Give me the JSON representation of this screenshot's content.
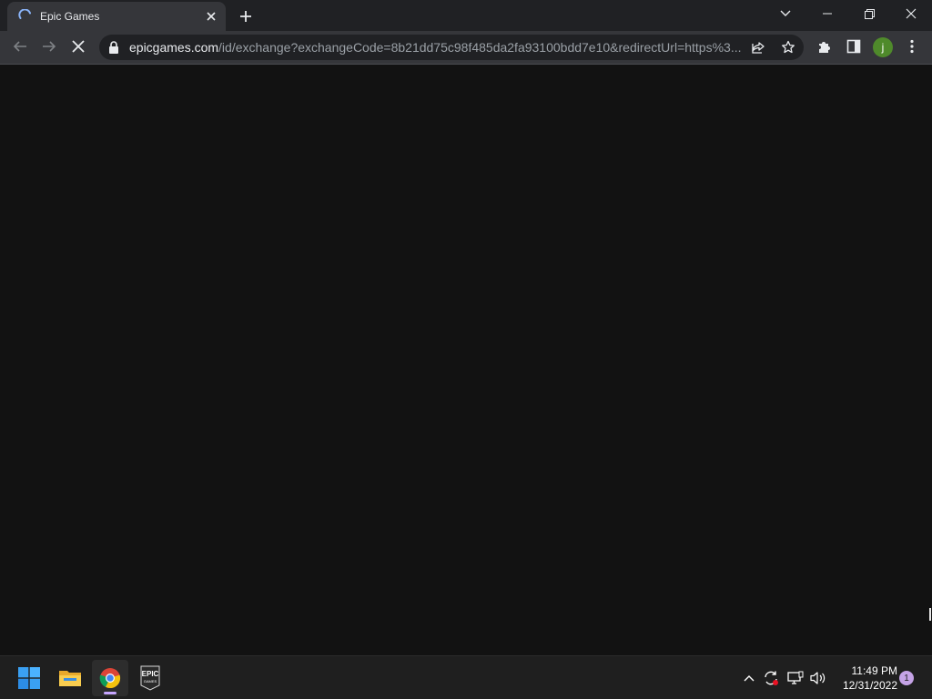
{
  "browser": {
    "tab": {
      "title": "Epic Games",
      "spinner_icon": "loading-spinner-icon"
    },
    "window_controls": [
      "chevron-down-icon",
      "minimize-icon",
      "restore-icon",
      "close-icon"
    ],
    "toolbar": {
      "url_host": "epicgames.com",
      "url_path": "/id/exchange?exchangeCode=8b21dd75c98f485da2fa93100bdd7e10&redirectUrl=https%3...",
      "profile_initial": "j"
    }
  },
  "taskbar": {
    "apps": [
      {
        "name": "Start",
        "icon": "windows-start-icon"
      },
      {
        "name": "File Explorer",
        "icon": "folder-icon"
      },
      {
        "name": "Google Chrome",
        "icon": "chrome-icon",
        "active": true
      },
      {
        "name": "Epic Games Launcher",
        "icon": "epic-games-icon",
        "label_top": "EPIC",
        "label_bottom": "GAMES"
      }
    ],
    "clock": {
      "time": "11:49 PM",
      "date": "12/31/2022"
    },
    "notification_count": "1"
  },
  "colors": {
    "tabstrip": "#202124",
    "toolbar": "#35363a",
    "content": "#121212",
    "taskbar": "#1f1f1f",
    "avatar": "#4f8a2b",
    "accent": "#c7a6ff"
  }
}
